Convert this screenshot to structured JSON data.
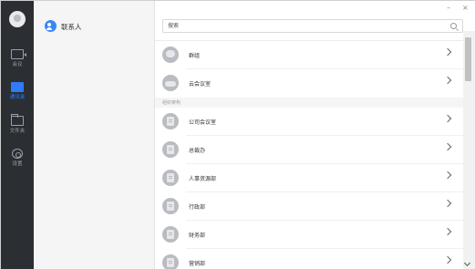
{
  "window": {
    "minimize_label": "–",
    "close_label": "×"
  },
  "rail": {
    "items": [
      {
        "label": "会议",
        "icon": "video-camera-icon",
        "active": false
      },
      {
        "label": "通讯录",
        "icon": "address-book-icon",
        "active": true
      },
      {
        "label": "文件夹",
        "icon": "folder-icon",
        "active": false
      },
      {
        "label": "设置",
        "icon": "gear-icon",
        "active": false
      }
    ]
  },
  "sidebar": {
    "contacts_label": "联系人"
  },
  "search": {
    "placeholder": "搜索"
  },
  "list": {
    "top_items": [
      {
        "name": "群组",
        "icon": "group-icon"
      },
      {
        "name": "云会议室",
        "icon": "cloud-icon"
      }
    ],
    "section_title": "组织架构",
    "departments": [
      {
        "name": "公司会议室"
      },
      {
        "name": "总裁办"
      },
      {
        "name": "人事资源部"
      },
      {
        "name": "行政部"
      },
      {
        "name": "财务部"
      },
      {
        "name": "营销部"
      }
    ]
  },
  "colors": {
    "rail_bg": "#2b2e33",
    "accent": "#2f7cf6",
    "sidebar_bg": "#f5f5f5"
  }
}
